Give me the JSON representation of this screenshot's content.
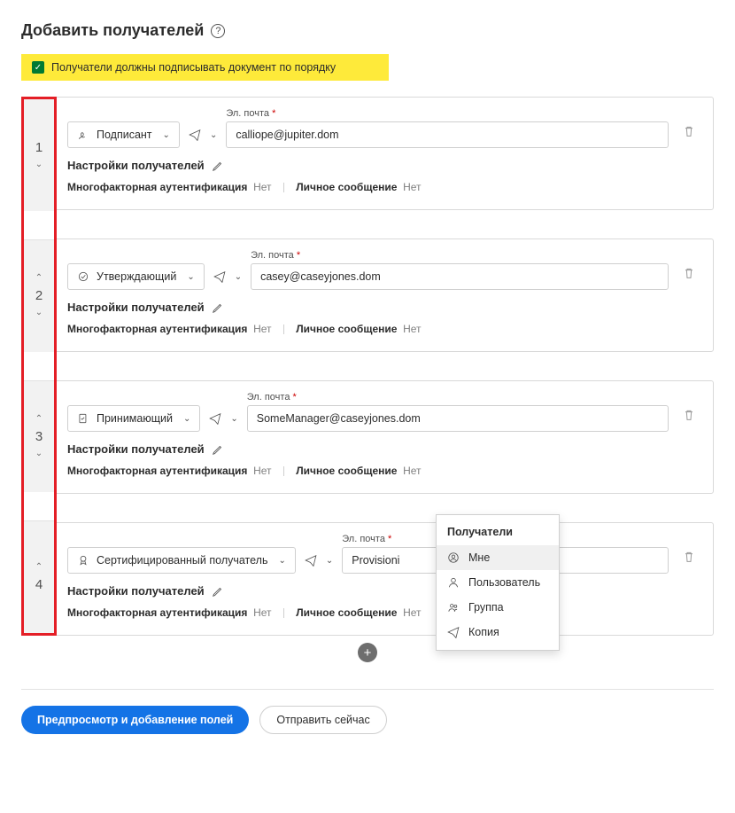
{
  "title": "Добавить получателей",
  "order_checkbox_label": "Получатели должны подписывать документ по порядку",
  "email_label": "Эл. почта",
  "recipient_settings_label": "Настройки получателей",
  "mfa_label": "Многофакторная аутентификация",
  "personal_msg_label": "Личное сообщение",
  "value_no": "Нет",
  "recipients": [
    {
      "order": "1",
      "role": "Подписант",
      "email": "calliope@jupiter.dom",
      "mfa": "Нет",
      "msg": "Нет",
      "has_up": false,
      "has_down": true
    },
    {
      "order": "2",
      "role": "Утверждающий",
      "email": "casey@caseyjones.dom",
      "mfa": "Нет",
      "msg": "Нет",
      "has_up": true,
      "has_down": true
    },
    {
      "order": "3",
      "role": "Принимающий",
      "email": "SomeManager@caseyjones.dom",
      "mfa": "Нет",
      "msg": "Нет",
      "has_up": true,
      "has_down": true
    },
    {
      "order": "4",
      "role": "Сертифицированный получатель",
      "email": "Provisioni",
      "mfa": "Нет",
      "msg": "Нет",
      "has_up": true,
      "has_down": false
    }
  ],
  "dropdown": {
    "title": "Получатели",
    "items": [
      "Мне",
      "Пользователь",
      "Группа",
      "Копия"
    ],
    "selected": 0
  },
  "buttons": {
    "preview": "Предпросмотр и добавление полей",
    "send_now": "Отправить сейчас"
  }
}
